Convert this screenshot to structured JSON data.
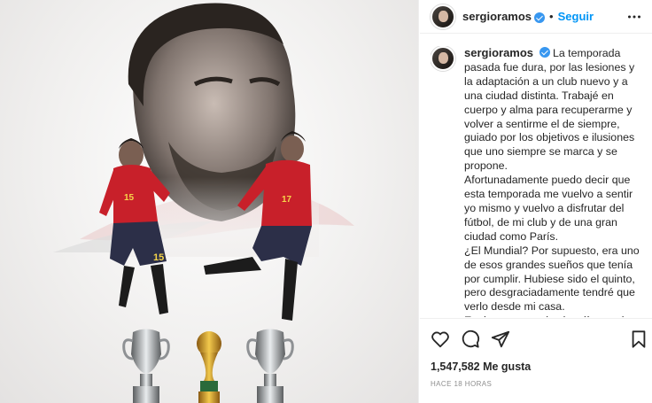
{
  "post": {
    "username": "sergioramos",
    "follow_label": "Seguir",
    "dot": "•",
    "caption": "La temporada pasada fue dura, por las lesiones y la adaptación a un club nuevo y a una ciudad distinta. Trabajé en cuerpo y alma para recuperarme y volver a sentirme el de siempre, guiado por los objetivos e ilusiones que uno siempre se marca y se propone.\nAfortunadamente puedo decir que esta temporada me vuelvo a sentir yo mismo y vuelvo a disfrutar del fútbol, de mi club y de una gran ciudad como París.\n¿El Mundial? Por supuesto, era uno de esos grandes sueños que tenía por cumplir. Hubiese sido el quinto, pero desgraciadamente tendré que verlo desde mi casa.\nEs duro, pero todos los días vuelve a salir el sol. No cambiará absolutamente nada en mí. Ni mi",
    "likes": "1,547,582 Me gusta",
    "time": "HACE 18 HORAS"
  },
  "image": {
    "jersey_numbers": [
      "15",
      "15",
      "17"
    ]
  },
  "icons": {
    "verified": "verified-badge-icon",
    "more": "more-options-icon",
    "like": "heart-icon",
    "comment": "comment-icon",
    "share": "share-icon",
    "save": "bookmark-icon"
  },
  "colors": {
    "follow": "#0095f6",
    "verified": "#3897f0",
    "jersey": "#c8202a"
  }
}
